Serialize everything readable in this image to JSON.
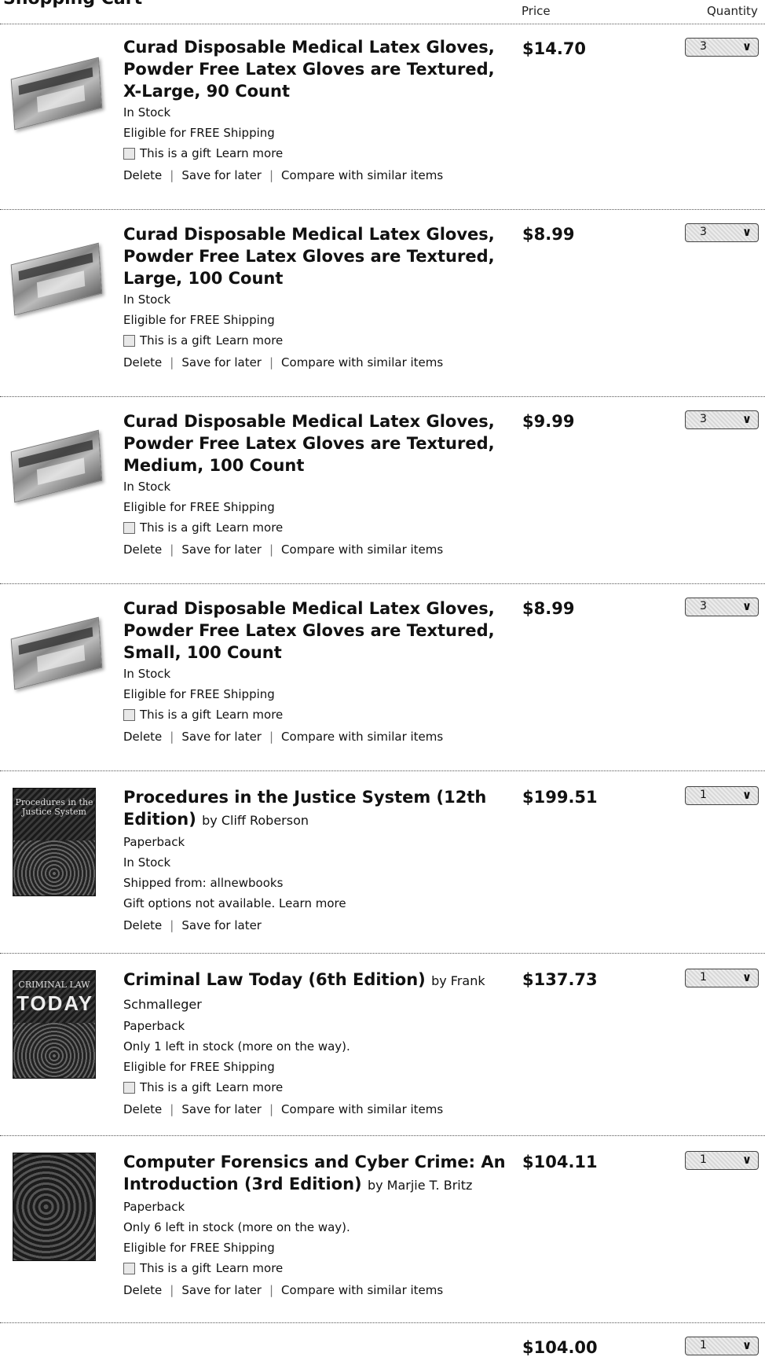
{
  "page": {
    "title": "Shopping Cart",
    "price_header": "Price",
    "quantity_header": "Quantity"
  },
  "labels": {
    "gift": "This is a gift",
    "learn_more": "Learn more",
    "delete": "Delete",
    "save_for_later": "Save for later",
    "compare": "Compare with similar items"
  },
  "items": [
    {
      "title": "Curad Disposable Medical Latex Gloves, Powder Free Latex Gloves are Textured, X-Large, 90 Count",
      "stock": "In Stock",
      "shipping": "Eligible for FREE Shipping",
      "price": "$14.70",
      "qty": "3"
    },
    {
      "title": "Curad Disposable Medical Latex Gloves, Powder Free Latex Gloves are Textured, Large, 100 Count",
      "stock": "In Stock",
      "shipping": "Eligible for FREE Shipping",
      "price": "$8.99",
      "qty": "3"
    },
    {
      "title": "Curad Disposable Medical Latex Gloves, Powder Free Latex Gloves are Textured, Medium, 100 Count",
      "stock": "In Stock",
      "shipping": "Eligible for FREE Shipping",
      "price": "$9.99",
      "qty": "3"
    },
    {
      "title": "Curad Disposable Medical Latex Gloves, Powder Free Latex Gloves are Textured, Small, 100 Count",
      "stock": "In Stock",
      "shipping": "Eligible for FREE Shipping",
      "price": "$8.99",
      "qty": "3"
    },
    {
      "title": "Procedures in the Justice System (12th Edition)",
      "author": "by Cliff Roberson",
      "format": "Paperback",
      "stock": "In Stock",
      "shipped_from": "Shipped from: allnewbooks",
      "gift_note": "Gift options not available. Learn more",
      "cover_text": "Procedures in the Justice System",
      "price": "$199.51",
      "qty": "1"
    },
    {
      "title": "Criminal Law Today (6th Edition)",
      "author": "by Frank Schmalleger",
      "format": "Paperback",
      "stock": "Only 1 left in stock (more on the way).",
      "shipping": "Eligible for FREE Shipping",
      "cover_text": "CRIMINAL LAW",
      "cover_text_big": "TODAY",
      "price": "$137.73",
      "qty": "1"
    },
    {
      "title": "Computer Forensics and Cyber Crime: An Introduction (3rd Edition)",
      "author": "by Marjie T. Britz",
      "format": "Paperback",
      "stock": "Only 6 left in stock (more on the way).",
      "shipping": "Eligible for FREE Shipping",
      "price": "$104.11",
      "qty": "1"
    },
    {
      "price": "$104.00",
      "qty": "1"
    }
  ]
}
